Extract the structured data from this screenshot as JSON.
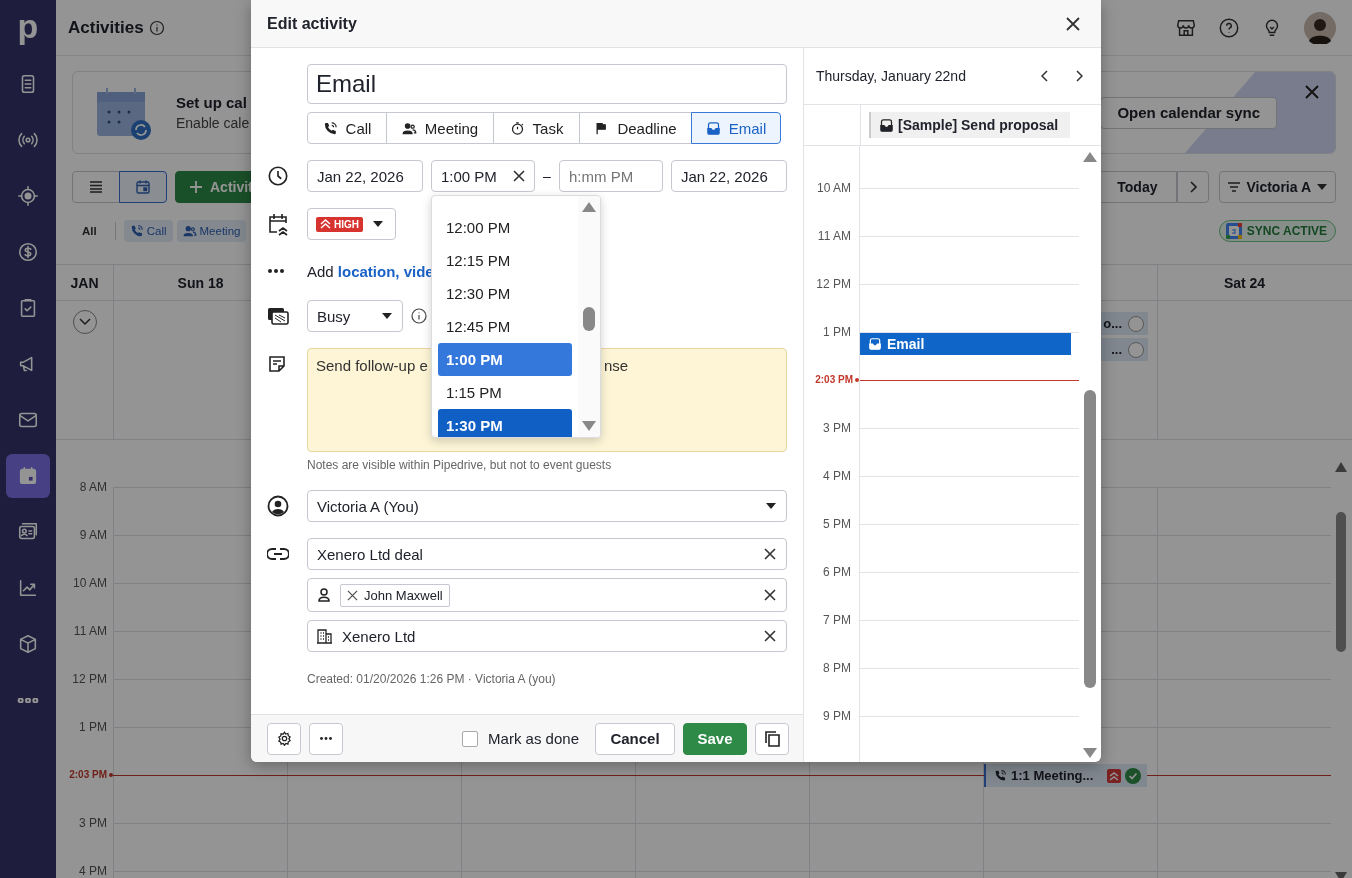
{
  "sidebar": {
    "logo": "p",
    "items": [
      {
        "selected": false
      },
      {
        "selected": false
      },
      {
        "selected": false
      },
      {
        "selected": false
      },
      {
        "selected": false
      },
      {
        "selected": false
      },
      {
        "selected": false
      },
      {
        "selected": true
      },
      {
        "selected": false
      },
      {
        "selected": false
      },
      {
        "selected": false
      },
      {
        "selected": false
      }
    ]
  },
  "header": {
    "title": "Activities"
  },
  "banner": {
    "title": "Set up cal",
    "text": "Enable cale",
    "button": "Open calendar sync"
  },
  "toolbar": {
    "views": [
      {
        "selected": false
      },
      {
        "selected": true
      }
    ],
    "add_button": "Activit",
    "today_button": "Today",
    "filter": "Victoria A"
  },
  "filters": [
    {
      "label": "All",
      "selected": false
    },
    {
      "label": "Call",
      "selected": true
    },
    {
      "label": "Meeting",
      "selected": true
    }
  ],
  "sync_badge": "SYNC ACTIVE",
  "calendar": {
    "month": "JAN",
    "first_day": "Sun 18",
    "last_day": "Sat 24",
    "all_day_events": [
      {
        "text": "o...",
        "done": false
      },
      {
        "text": "...",
        "done": false
      }
    ],
    "rows": [
      {
        "kind": "hour",
        "label": "8 AM"
      },
      {
        "kind": "hour",
        "label": "9 AM"
      },
      {
        "kind": "hour",
        "label": "10 AM"
      },
      {
        "kind": "hour",
        "label": "11 AM"
      },
      {
        "kind": "hour",
        "label": "12 PM"
      },
      {
        "kind": "hour",
        "label": "1 PM"
      },
      {
        "kind": "now",
        "label": "2:03 PM",
        "event": {
          "text": "1:1 Meeting...",
          "priority_high": true,
          "done": true
        }
      },
      {
        "kind": "hour",
        "label": "3 PM"
      },
      {
        "kind": "hour",
        "label": "4 PM"
      }
    ]
  },
  "edit_activity": {
    "title": "Edit activity",
    "subject": "Email",
    "types": [
      {
        "label": "Call",
        "selected": false
      },
      {
        "label": "Meeting",
        "selected": false
      },
      {
        "label": "Task",
        "selected": false
      },
      {
        "label": "Deadline",
        "selected": false
      },
      {
        "label": "Email",
        "selected": true
      }
    ],
    "start_date": "Jan 22, 2026",
    "start_time": "1:00 PM",
    "range_separator": "–",
    "end_time_placeholder": "h:mm PM",
    "end_date": "Jan 22, 2026",
    "time_options": [
      {
        "label": "12:00 PM",
        "selected": false,
        "hovered": false
      },
      {
        "label": "12:15 PM",
        "selected": false,
        "hovered": false
      },
      {
        "label": "12:30 PM",
        "selected": false,
        "hovered": false
      },
      {
        "label": "12:45 PM",
        "selected": false,
        "hovered": false
      },
      {
        "label": "1:00 PM",
        "selected": true,
        "hovered": false
      },
      {
        "label": "1:15 PM",
        "selected": false,
        "hovered": false
      },
      {
        "label": "1:30 PM",
        "selected": false,
        "hovered": true
      }
    ],
    "priority": "HIGH",
    "add_prefix": "Add",
    "add_link": "location, vide",
    "availability": "Busy",
    "note_start": "Send follow-up e",
    "note_end": "nse",
    "note_hint": "Notes are visible within Pipedrive, but not to event guests",
    "owner": "Victoria A (You)",
    "deal": "Xenero Ltd deal",
    "person": "John Maxwell",
    "organization": "Xenero Ltd",
    "created": "Created: 01/20/2026 1:26 PM · Victoria A (you)",
    "mark_done": {
      "label": "Mark as done",
      "checked": false
    },
    "cancel": "Cancel",
    "save": "Save",
    "day_view": {
      "date": "Thursday, January 22nd",
      "all_day_event": "[Sample] Send proposal",
      "rows": [
        {
          "kind": "hour",
          "label": "10 AM"
        },
        {
          "kind": "hour",
          "label": "11 AM"
        },
        {
          "kind": "hour",
          "label": "12 PM"
        },
        {
          "kind": "hour",
          "label": "1 PM",
          "event": "Email"
        },
        {
          "kind": "now",
          "label": "2:03 PM"
        },
        {
          "kind": "hour",
          "label": "3 PM"
        },
        {
          "kind": "hour",
          "label": "4 PM"
        },
        {
          "kind": "hour",
          "label": "5 PM"
        },
        {
          "kind": "hour",
          "label": "6 PM"
        },
        {
          "kind": "hour",
          "label": "7 PM"
        },
        {
          "kind": "hour",
          "label": "8 PM"
        },
        {
          "kind": "hour",
          "label": "9 PM"
        }
      ]
    }
  }
}
